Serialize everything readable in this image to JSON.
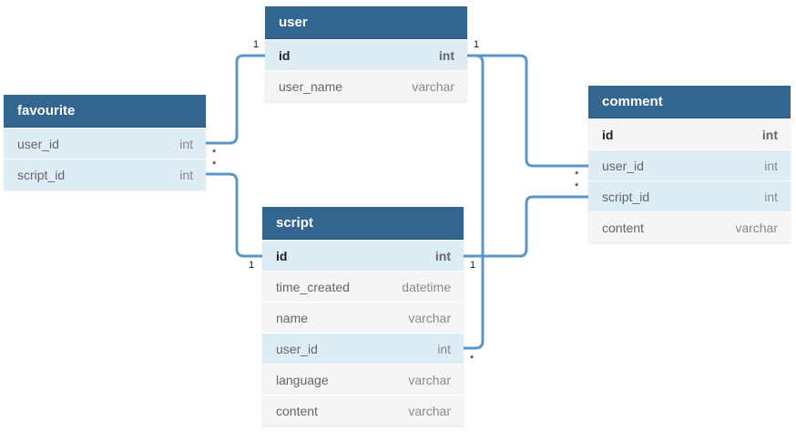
{
  "tables": [
    {
      "name": "user",
      "fields": [
        {
          "name": "id",
          "type": "int",
          "pk": true,
          "hl": true
        },
        {
          "name": "user_name",
          "type": "varchar",
          "pk": false,
          "hl": false
        }
      ]
    },
    {
      "name": "favourite",
      "fields": [
        {
          "name": "user_id",
          "type": "int",
          "pk": false,
          "hl": true
        },
        {
          "name": "script_id",
          "type": "int",
          "pk": false,
          "hl": true
        }
      ]
    },
    {
      "name": "comment",
      "fields": [
        {
          "name": "id",
          "type": "int",
          "pk": true,
          "hl": false
        },
        {
          "name": "user_id",
          "type": "int",
          "pk": false,
          "hl": true
        },
        {
          "name": "script_id",
          "type": "int",
          "pk": false,
          "hl": true
        },
        {
          "name": "content",
          "type": "varchar",
          "pk": false,
          "hl": false
        }
      ]
    },
    {
      "name": "script",
      "fields": [
        {
          "name": "id",
          "type": "int",
          "pk": true,
          "hl": true
        },
        {
          "name": "time_created",
          "type": "datetime",
          "pk": false,
          "hl": false
        },
        {
          "name": "name",
          "type": "varchar",
          "pk": false,
          "hl": false
        },
        {
          "name": "user_id",
          "type": "int",
          "pk": false,
          "hl": true
        },
        {
          "name": "language",
          "type": "varchar",
          "pk": false,
          "hl": false
        },
        {
          "name": "content",
          "type": "varchar",
          "pk": false,
          "hl": false
        }
      ]
    }
  ],
  "relationships": [
    {
      "from": "favourite.user_id",
      "to": "user.id",
      "from_card": "*",
      "to_card": "1"
    },
    {
      "from": "favourite.script_id",
      "to": "script.id",
      "from_card": "*",
      "to_card": "1"
    },
    {
      "from": "comment.user_id",
      "to": "user.id",
      "from_card": "*",
      "to_card": "1"
    },
    {
      "from": "comment.script_id",
      "to": "script.id",
      "from_card": "*",
      "to_card": "1"
    },
    {
      "from": "script.user_id",
      "to": "user.id",
      "from_card": "*",
      "to_card": "1"
    }
  ],
  "colors": {
    "header": "#326690",
    "link": "#5b97c6",
    "highlight": "#deecf6",
    "row": "#f5f5f5"
  }
}
